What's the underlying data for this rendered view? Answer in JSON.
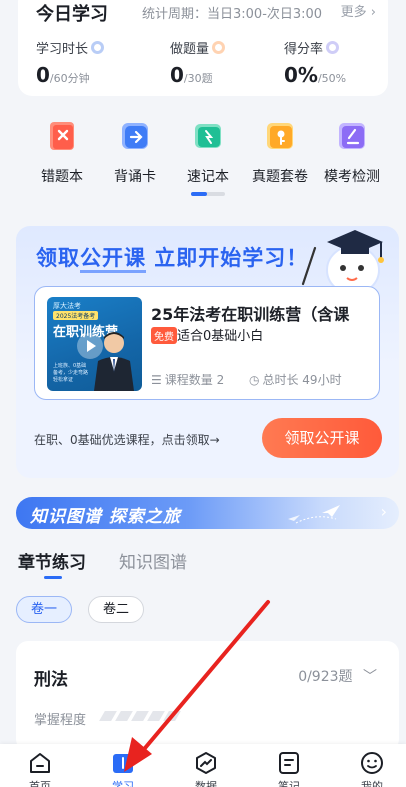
{
  "stats": {
    "title": "今日学习",
    "period": "统计周期：当日3:00-次日3:00",
    "more": "更多",
    "items": [
      {
        "label": "学习时长",
        "value": "0",
        "unit": "/60分钟"
      },
      {
        "label": "做题量",
        "value": "0",
        "unit": "/30题"
      },
      {
        "label": "得分率",
        "value": "0%",
        "unit": "/50%"
      }
    ]
  },
  "tools": [
    {
      "label": "错题本",
      "icon": "wrong-book-icon"
    },
    {
      "label": "背诵卡",
      "icon": "recite-card-icon"
    },
    {
      "label": "速记本",
      "icon": "quick-notes-icon"
    },
    {
      "label": "真题套卷",
      "icon": "real-exam-icon"
    },
    {
      "label": "模考检测",
      "icon": "mock-exam-icon"
    }
  ],
  "promo": {
    "headline_pre": "领取",
    "headline_mid": "公开课",
    "headline_post": " 立即开始学习！",
    "course_title": "25年法考在职训练营（含课",
    "free_badge": "免费",
    "course_subtitle": "适合0基础小白",
    "lesson_count": "课程数量 2",
    "duration": "总时长 49小时",
    "hint": "在职、0基础优选课程，点击领取→",
    "button": "领取公开课",
    "thumb_brand": "厚大法考",
    "thumb_ribbon": "2025法考备考",
    "thumb_title": "在职训练营",
    "thumb_text": "上班族、0基础备考，少走弯路 轻松拿证"
  },
  "knowledge_banner": {
    "title": "知识图谱 探索之旅",
    "arrow": "›"
  },
  "section_tabs": {
    "active": "章节练习",
    "inactive": "知识图谱"
  },
  "volumes": {
    "active": "卷一",
    "inactive": "卷二"
  },
  "subject": {
    "name": "刑法",
    "count": "0/923题",
    "mastery_label": "掌握程度",
    "mastery": 0
  },
  "nav": [
    {
      "label": "首页",
      "icon": "home-icon"
    },
    {
      "label": "学习",
      "icon": "study-icon"
    },
    {
      "label": "数据",
      "icon": "data-icon"
    },
    {
      "label": "笔记",
      "icon": "notes-icon"
    },
    {
      "label": "我的",
      "icon": "profile-icon"
    }
  ],
  "colors": {
    "accent": "#2b6cf6",
    "promo_button": "#ff5a3a",
    "annotation_arrow": "#e8231f"
  }
}
